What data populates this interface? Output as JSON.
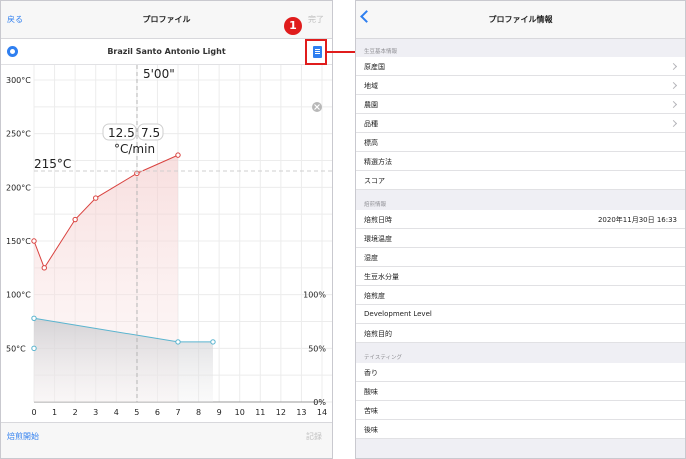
{
  "left": {
    "nav": {
      "back": "戻る",
      "title": "プロファイル",
      "done": "完了"
    },
    "bean_name": "Brazil Santo Antonio Light",
    "footer": {
      "start": "焙煎開始",
      "record": "記録"
    }
  },
  "chart_data": {
    "type": "line",
    "time_marker": "5'00\"",
    "x": {
      "ticks": [
        "0",
        "1",
        "2",
        "3",
        "4",
        "5",
        "6",
        "7",
        "8",
        "9",
        "10",
        "11",
        "12",
        "13",
        "14"
      ],
      "range": [
        0,
        14
      ]
    },
    "y_left": {
      "ticks": [
        "300°C",
        "250°C",
        "200°C",
        "150°C",
        "100°C",
        "50°C"
      ],
      "range": [
        0,
        300
      ]
    },
    "y_right": {
      "ticks": [
        "100%",
        "50%",
        "0%"
      ],
      "range": [
        0,
        100
      ]
    },
    "series": [
      {
        "color": "#d9423f",
        "x": [
          0,
          0.5,
          2,
          3,
          5,
          7
        ],
        "y": [
          150,
          125,
          170,
          190,
          213,
          230
        ]
      },
      {
        "color": "#5ab4cf",
        "x": [
          0,
          7,
          8.7
        ],
        "y": [
          78,
          56,
          56
        ]
      }
    ],
    "target_temp": {
      "label": "215°C",
      "value": 215
    },
    "readout": {
      "left": "12.5",
      "right": "7.5",
      "unit": "°C/min"
    },
    "extra_point": {
      "x": 0,
      "y": 50
    }
  },
  "annotation": {
    "number": "1"
  },
  "right": {
    "nav": {
      "title": "プロファイル情報"
    },
    "sections": [
      {
        "header": "生豆基本情報",
        "rows": [
          {
            "label": "原産国",
            "value": "",
            "chevron": true
          },
          {
            "label": "地域",
            "value": "",
            "chevron": true
          },
          {
            "label": "農園",
            "value": "",
            "chevron": true
          },
          {
            "label": "品種",
            "value": "",
            "chevron": true
          },
          {
            "label": "標高",
            "value": "",
            "chevron": false
          },
          {
            "label": "精選方法",
            "value": "",
            "chevron": false
          },
          {
            "label": "スコア",
            "value": "",
            "chevron": false
          }
        ]
      },
      {
        "header": "焙煎情報",
        "rows": [
          {
            "label": "焙煎日時",
            "value": "2020年11月30日 16:33",
            "chevron": false
          },
          {
            "label": "環境温度",
            "value": "",
            "chevron": false
          },
          {
            "label": "湿度",
            "value": "",
            "chevron": false
          },
          {
            "label": "生豆水分量",
            "value": "",
            "chevron": false
          },
          {
            "label": "焙煎度",
            "value": "",
            "chevron": false
          },
          {
            "label": "Development Level",
            "value": "",
            "chevron": false
          },
          {
            "label": "焙煎目的",
            "value": "",
            "chevron": false
          }
        ]
      },
      {
        "header": "テイスティング",
        "rows": [
          {
            "label": "香り",
            "value": "",
            "chevron": false
          },
          {
            "label": "酸味",
            "value": "",
            "chevron": false
          },
          {
            "label": "苦味",
            "value": "",
            "chevron": false
          },
          {
            "label": "後味",
            "value": "",
            "chevron": false
          }
        ]
      }
    ]
  }
}
